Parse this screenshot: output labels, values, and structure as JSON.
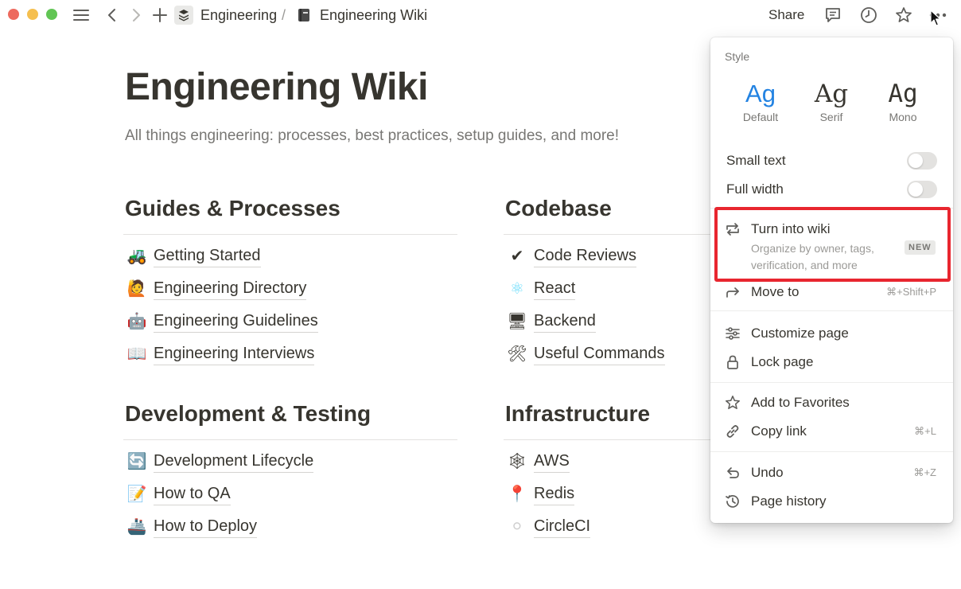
{
  "topbar": {
    "breadcrumb_parent": "Engineering",
    "breadcrumb_separator": "/",
    "breadcrumb_current": "Engineering Wiki",
    "share_label": "Share"
  },
  "page": {
    "title": "Engineering Wiki",
    "description": "All things engineering: processes, best practices, setup guides, and more!"
  },
  "sections": [
    {
      "title": "Guides & Processes",
      "items": [
        {
          "icon": "tractor-icon",
          "emoji": "🚜",
          "label": "Getting Started"
        },
        {
          "icon": "person-icon",
          "emoji": "🙋",
          "label": "Engineering Directory"
        },
        {
          "icon": "robot-icon",
          "emoji": "🤖",
          "label": "Engineering Guidelines"
        },
        {
          "icon": "book-icon",
          "emoji": "📖",
          "label": "Engineering Interviews"
        }
      ]
    },
    {
      "title": "Codebase",
      "items": [
        {
          "icon": "checkmark-icon",
          "emoji": "✔",
          "label": "Code Reviews"
        },
        {
          "icon": "atom-icon",
          "emoji": "⚛",
          "label": "React"
        },
        {
          "icon": "monitor-icon",
          "emoji": "🖥",
          "label": "Backend"
        },
        {
          "icon": "tools-icon",
          "emoji": "🛠",
          "label": "Useful Commands"
        }
      ]
    },
    {
      "title": "Development & Testing",
      "items": [
        {
          "icon": "cycle-icon",
          "emoji": "🔄",
          "label": "Development Lifecycle"
        },
        {
          "icon": "memo-icon",
          "emoji": "📝",
          "label": "How to QA"
        },
        {
          "icon": "ship-icon",
          "emoji": "🚢",
          "label": "How to Deploy"
        }
      ]
    },
    {
      "title": "Infrastructure",
      "items": [
        {
          "icon": "spiderweb-icon",
          "emoji": "🕸",
          "label": "AWS"
        },
        {
          "icon": "pushpin-icon",
          "emoji": "📍",
          "label": "Redis"
        },
        {
          "icon": "circle-icon",
          "emoji": "⚪",
          "label": "CircleCI"
        }
      ]
    }
  ],
  "menu": {
    "style_heading": "Style",
    "styles": [
      {
        "glyph": "Ag",
        "label": "Default",
        "selected": true
      },
      {
        "glyph": "Ag",
        "label": "Serif",
        "selected": false
      },
      {
        "glyph": "Ag",
        "label": "Mono",
        "selected": false
      }
    ],
    "small_text": {
      "label": "Small text",
      "on": false
    },
    "full_width": {
      "label": "Full width",
      "on": false
    },
    "turn_into_wiki": {
      "label": "Turn into wiki",
      "description": "Organize by owner, tags, verification, and more",
      "badge": "NEW"
    },
    "move_to": {
      "label": "Move to",
      "shortcut": "⌘+Shift+P"
    },
    "customize_page": {
      "label": "Customize page"
    },
    "lock_page": {
      "label": "Lock page"
    },
    "add_to_favorites": {
      "label": "Add to Favorites"
    },
    "copy_link": {
      "label": "Copy link",
      "shortcut": "⌘+L"
    },
    "undo": {
      "label": "Undo",
      "shortcut": "⌘+Z"
    },
    "page_history": {
      "label": "Page history"
    }
  },
  "colors": {
    "accent": "#2383e2",
    "highlight": "#e8262f",
    "text": "#37352f",
    "muted": "#787774"
  }
}
